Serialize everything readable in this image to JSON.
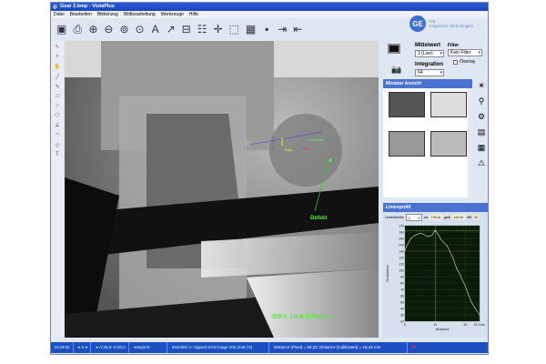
{
  "window": {
    "title": "Gear 2.bmp - VistaPlus"
  },
  "menu": [
    "Datei",
    "Bearbeiten",
    "Bildeinzug",
    "Bildbearbeitung",
    "Werkzeuge",
    "Hilfe"
  ],
  "toolbar_icons": [
    "comment-icon",
    "print-icon",
    "zoom-in-icon",
    "zoom-out-icon",
    "zoom-fit-icon",
    "zoom-100-icon",
    "text-icon",
    "arrow-icon",
    "measure-icon",
    "profile-icon",
    "crosshair-icon",
    "select-icon",
    "grid-icon",
    "monitor-icon",
    "export-icon",
    "import-icon"
  ],
  "brand": {
    "name": "GE",
    "subtitle1": "GE",
    "subtitle2": "Inspection Technologies"
  },
  "controls": {
    "mittelwert_label": "Mittelwert",
    "mittelwert_value": "1 (Live)",
    "filter_label": "Filter",
    "filter_value": "Kein Filter",
    "integration_label": "Integration",
    "integration_value": "64",
    "overlay_label": "Overlay"
  },
  "miniatur": {
    "title": "Miniatur Ansicht"
  },
  "linienprofil": {
    "title": "Linienprofil",
    "linienbreite_label": "Linienbreite",
    "linienbreite_value": "2",
    "rot_label": "rot",
    "rot_value": "130,6r",
    "gelb_label": "gelb",
    "gelb_value": "162,6r",
    "diff_label": "diff",
    "diff_value": "32"
  },
  "image": {
    "annotations": {
      "a1": "Intensität",
      "a2": "Steg",
      "a3": "Rot",
      "defect": "Defekt",
      "caption": "80kV, 1mA 8 Frames"
    }
  },
  "status": {
    "time": "13:40:52",
    "coords": "A:36,8; D:30,0",
    "mode": "Integriert",
    "image_info": "992x992 U: Signed 8-bit image 206  (446,74)",
    "distance": "Distance (Pixel) = 56,32; Distance (Calibrated) = 18,43 mm"
  },
  "chart_data": {
    "type": "line",
    "xlabel": "Abstand",
    "ylabel": "Grauwerte",
    "xlim": [
      0,
      24.7
    ],
    "ylim": [
      20,
      170
    ],
    "xticks": [
      "0",
      "10",
      "20",
      "24,7mm"
    ],
    "yticks": [
      "20",
      "30",
      "40",
      "50",
      "60",
      "70",
      "80",
      "90",
      "100",
      "110",
      "120",
      "130",
      "140",
      "150",
      "160",
      "170"
    ],
    "red_line": 130.6,
    "yellow_line": 162.6,
    "yellow_x": 10,
    "x": [
      0,
      1,
      2,
      3,
      4,
      5,
      6,
      7,
      8,
      9,
      10,
      11,
      12,
      13,
      14,
      15,
      16,
      17,
      18,
      19,
      20,
      21,
      22,
      23,
      24,
      24.7
    ],
    "y": [
      131,
      142,
      150,
      154,
      156,
      158,
      157,
      154,
      153,
      155,
      163,
      156,
      148,
      143,
      138,
      128,
      118,
      104,
      95,
      85,
      75,
      62,
      50,
      42,
      35,
      30
    ]
  }
}
